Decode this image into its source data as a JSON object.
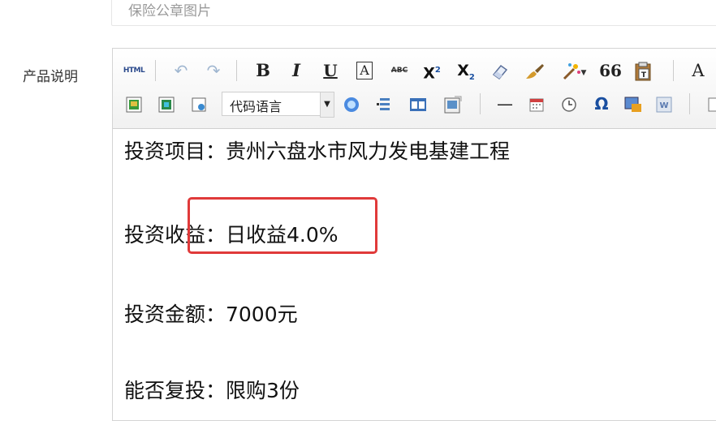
{
  "form": {
    "previous_field_placeholder": "保险公章图片",
    "product_desc_label": "产品说明"
  },
  "toolbar": {
    "html_label": "HTML",
    "bold_label": "B",
    "italic_label": "I",
    "underline_label": "U",
    "boxed_a_label": "A",
    "strike_label": "ABC",
    "superscript_label": "X",
    "superscript_mark": "2",
    "subscript_label": "X",
    "subscript_mark": "2",
    "quote_label": "66",
    "fontcolor_label": "A",
    "code_language_value": "代码语言",
    "horizontal_rule_label": "—",
    "special_char_label": "Ω"
  },
  "content": {
    "paragraphs": [
      "投资项目：贵州六盘水市风力发电基建工程",
      "投资收益：日收益4.0%",
      "投资金额：7000元",
      "能否复投：限购3份"
    ]
  },
  "colors": {
    "highlight_border": "#e03a3a",
    "toolbar_bg": "#f1f1f1",
    "border": "#d4d4d4"
  }
}
